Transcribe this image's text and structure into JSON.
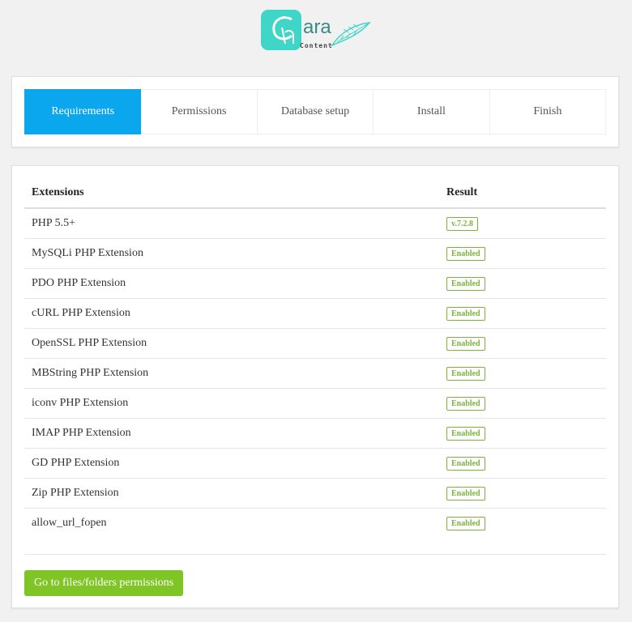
{
  "logo": {
    "text": "ara",
    "subtext": "Content",
    "brand_color": "#3fd6c8"
  },
  "steps": [
    {
      "label": "Requirements",
      "active": true
    },
    {
      "label": "Permissions",
      "active": false
    },
    {
      "label": "Database setup",
      "active": false
    },
    {
      "label": "Install",
      "active": false
    },
    {
      "label": "Finish",
      "active": false
    }
  ],
  "table": {
    "headers": {
      "extension": "Extensions",
      "result": "Result"
    },
    "rows": [
      {
        "name": "PHP 5.5+",
        "result": "v.7.2.8"
      },
      {
        "name": "MySQLi PHP Extension",
        "result": "Enabled"
      },
      {
        "name": "PDO PHP Extension",
        "result": "Enabled"
      },
      {
        "name": "cURL PHP Extension",
        "result": "Enabled"
      },
      {
        "name": "OpenSSL PHP Extension",
        "result": "Enabled"
      },
      {
        "name": "MBString PHP Extension",
        "result": "Enabled"
      },
      {
        "name": "iconv PHP Extension",
        "result": "Enabled"
      },
      {
        "name": "IMAP PHP Extension",
        "result": "Enabled"
      },
      {
        "name": "GD PHP Extension",
        "result": "Enabled"
      },
      {
        "name": "Zip PHP Extension",
        "result": "Enabled"
      },
      {
        "name": "allow_url_fopen",
        "result": "Enabled"
      }
    ]
  },
  "next_button": {
    "label": "Go to files/folders permissions"
  },
  "colors": {
    "active_step": "#0aa6ee",
    "badge_ok": "#7bb33d",
    "button": "#7fc526"
  }
}
